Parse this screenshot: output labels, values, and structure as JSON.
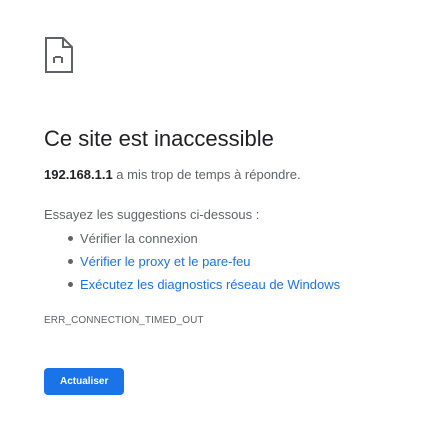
{
  "icon": "broken-page-icon",
  "title": "Ce site est inaccessible",
  "summary": {
    "host": "192.168.1.1",
    "message": " a mis trop de temps à répondre."
  },
  "suggestions": {
    "intro": "Essayez les suggestions ci-dessous :",
    "items": [
      "Vérifier la connexion",
      "Vérifier le proxy et le pare-feu",
      "Exécutez les diagnostics réseau de Windows"
    ]
  },
  "error_code": "ERR_CONNECTION_TIMED_OUT",
  "reload_button": "Actualiser",
  "colors": {
    "accent": "#1a73e8",
    "text": "#202124",
    "secondary": "#5f6368"
  }
}
